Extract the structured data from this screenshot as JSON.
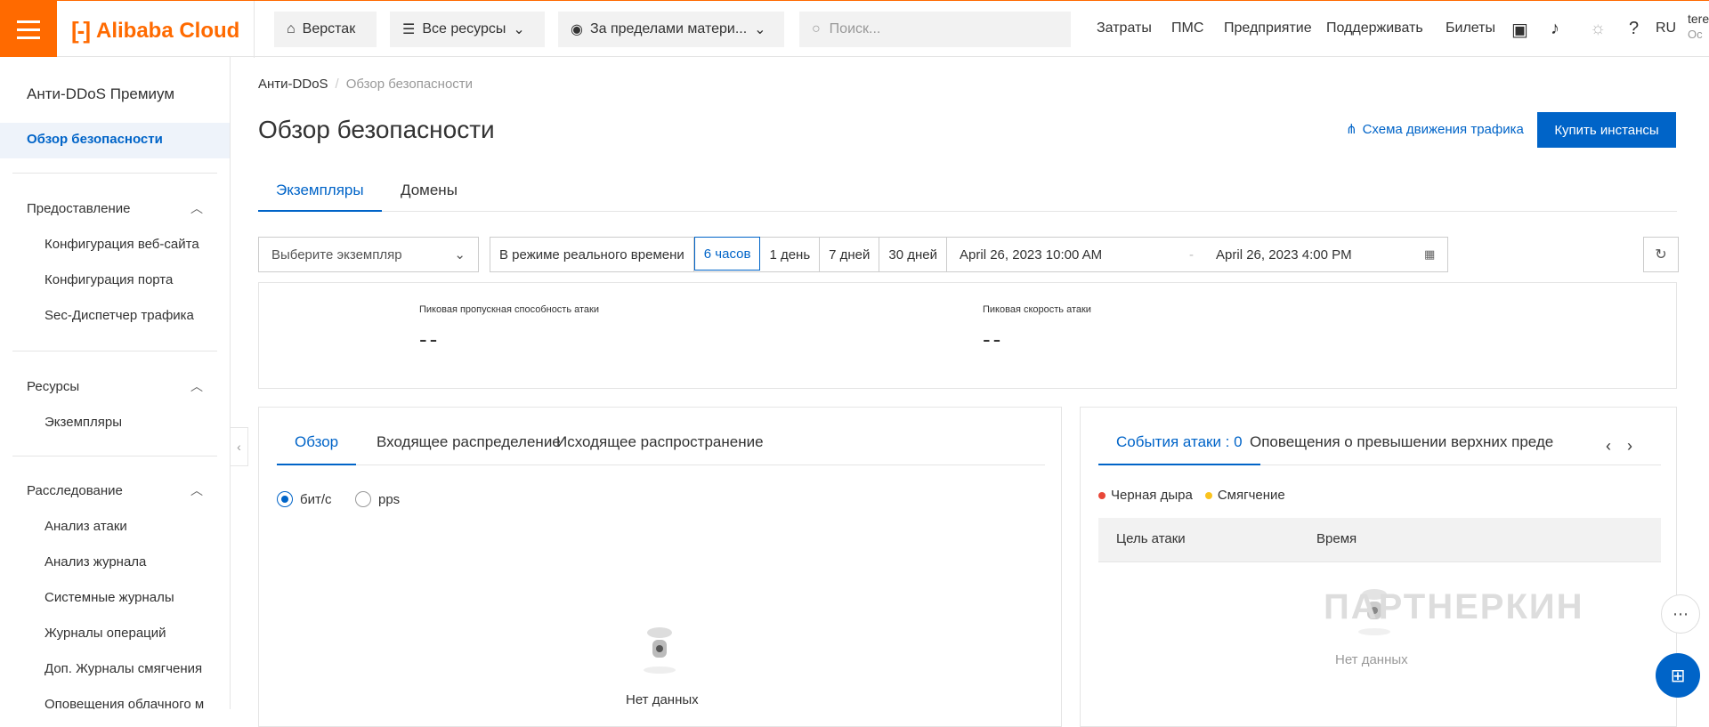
{
  "topbar": {
    "brand": "Alibaba Cloud",
    "workbench": "Верстак",
    "all_resources": "Все ресурсы",
    "region": "За пределами матери...",
    "search_placeholder": "Поиск...",
    "links": [
      "Затраты",
      "ПМС",
      "Предприятие",
      "Поддерживать",
      "Билеты"
    ],
    "lang": "RU",
    "user_line1": "tere",
    "user_line2": "Oc"
  },
  "sidebar": {
    "title": "Анти-DDoS Премиум",
    "active": "Обзор безопасности",
    "groups": [
      {
        "label": "Предоставление",
        "items": [
          "Конфигурация веб-сайта",
          "Конфигурация порта",
          "Sec-Диспетчер трафика"
        ]
      },
      {
        "label": "Ресурсы",
        "items": [
          "Экземпляры"
        ]
      },
      {
        "label": "Расследование",
        "items": [
          "Анализ атаки",
          "Анализ журнала",
          "Системные журналы",
          "Журналы операций",
          "Доп. Журналы смягчения",
          "Оповещения облачного м"
        ]
      }
    ]
  },
  "breadcrumb": {
    "root": "Анти-DDoS",
    "current": "Обзор безопасности"
  },
  "page_title": "Обзор безопасности",
  "flow_link": "Схема движения трафика",
  "buy_button": "Купить инстансы",
  "tabs": [
    "Экземпляры",
    "Домены"
  ],
  "filters": {
    "instance_placeholder": "Выберите экземпляр",
    "realtime": "В режиме реального времени",
    "ranges": [
      "6 часов",
      "1 день",
      "7 дней",
      "30 дней"
    ],
    "start": "April 26, 2023 10:00 AM",
    "range_sep": "-",
    "end": "April 26, 2023 4:00 PM"
  },
  "stats": {
    "bandwidth_label": "Пиковая пропускная способность атаки",
    "bandwidth_value": "--",
    "rate_label": "Пиковая скорость атаки",
    "rate_value": "--"
  },
  "left_card": {
    "tabs": [
      "Обзор",
      "Входящее распределение",
      "Исходящее распространение"
    ],
    "radio_bits": "бит/с",
    "radio_pps": "pps",
    "empty": "Нет данных"
  },
  "right_card": {
    "tabs": [
      "События атаки : 0",
      "Оповещения о превышении верхних преде"
    ],
    "legend_blackhole": "Черная дыра",
    "legend_mitigation": "Смягчение",
    "col_target": "Цель атаки",
    "col_time": "Время",
    "empty": "Нет данных"
  },
  "watermark": "ПАРТНЕРКИН",
  "colors": {
    "accent": "#0064c8",
    "brand": "#ff6a00",
    "blackhole": "#e84738",
    "mitigation": "#fac31e"
  }
}
